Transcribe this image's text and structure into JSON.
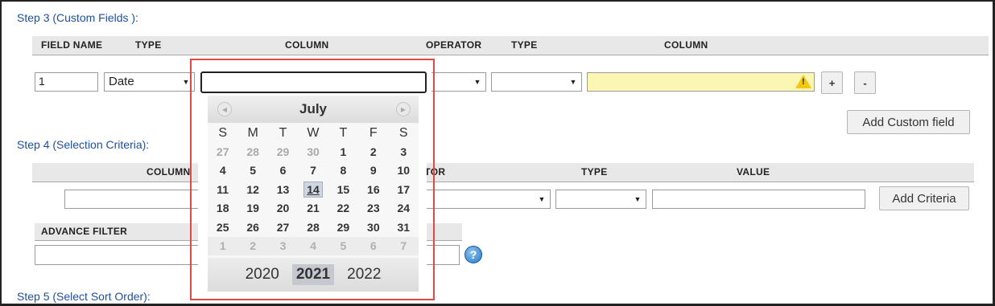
{
  "step3": {
    "title": "Step 3 (Custom Fields ):",
    "headers": {
      "field_name": "Field Name",
      "type": "Type",
      "column": "Column",
      "operator": "Operator",
      "type2": "Type",
      "column2": "Column"
    },
    "field_name_value": "1",
    "type_value": "Date",
    "column_value": "",
    "operator_value": "",
    "type2_value": "",
    "plus_label": "+",
    "minus_label": "-",
    "add_custom_field_label": "Add Custom field"
  },
  "calendar": {
    "month": "July",
    "weekdays": [
      "S",
      "M",
      "T",
      "W",
      "T",
      "F",
      "S"
    ],
    "weeks": [
      [
        [
          "27",
          true
        ],
        [
          "28",
          true
        ],
        [
          "29",
          true
        ],
        [
          "30",
          true
        ],
        [
          "1",
          false
        ],
        [
          "2",
          false
        ],
        [
          "3",
          false
        ]
      ],
      [
        [
          "4",
          false
        ],
        [
          "5",
          false
        ],
        [
          "6",
          false
        ],
        [
          "7",
          false
        ],
        [
          "8",
          false
        ],
        [
          "9",
          false
        ],
        [
          "10",
          false
        ]
      ],
      [
        [
          "11",
          false
        ],
        [
          "12",
          false
        ],
        [
          "13",
          false
        ],
        [
          "14",
          false
        ],
        [
          "15",
          false
        ],
        [
          "16",
          false
        ],
        [
          "17",
          false
        ]
      ],
      [
        [
          "18",
          false
        ],
        [
          "19",
          false
        ],
        [
          "20",
          false
        ],
        [
          "21",
          false
        ],
        [
          "22",
          false
        ],
        [
          "23",
          false
        ],
        [
          "24",
          false
        ]
      ],
      [
        [
          "25",
          false
        ],
        [
          "26",
          false
        ],
        [
          "27",
          false
        ],
        [
          "28",
          false
        ],
        [
          "29",
          false
        ],
        [
          "30",
          false
        ],
        [
          "31",
          false
        ]
      ],
      [
        [
          "1",
          true
        ],
        [
          "2",
          true
        ],
        [
          "3",
          true
        ],
        [
          "4",
          true
        ],
        [
          "5",
          true
        ],
        [
          "6",
          true
        ],
        [
          "7",
          true
        ]
      ]
    ],
    "today": "14",
    "years": [
      "2020",
      "2021",
      "2022"
    ],
    "selected_year": "2021"
  },
  "step4": {
    "title": "Step 4 (Selection Criteria):",
    "headers": {
      "column": "Column",
      "operator": "Operator",
      "type": "Type",
      "value": "Value"
    },
    "add_criteria_label": "Add Criteria"
  },
  "advance_filter": {
    "header": "Advance Filter",
    "help_label": "?"
  },
  "step5": {
    "title": "Step 5 (Select Sort Order):"
  }
}
